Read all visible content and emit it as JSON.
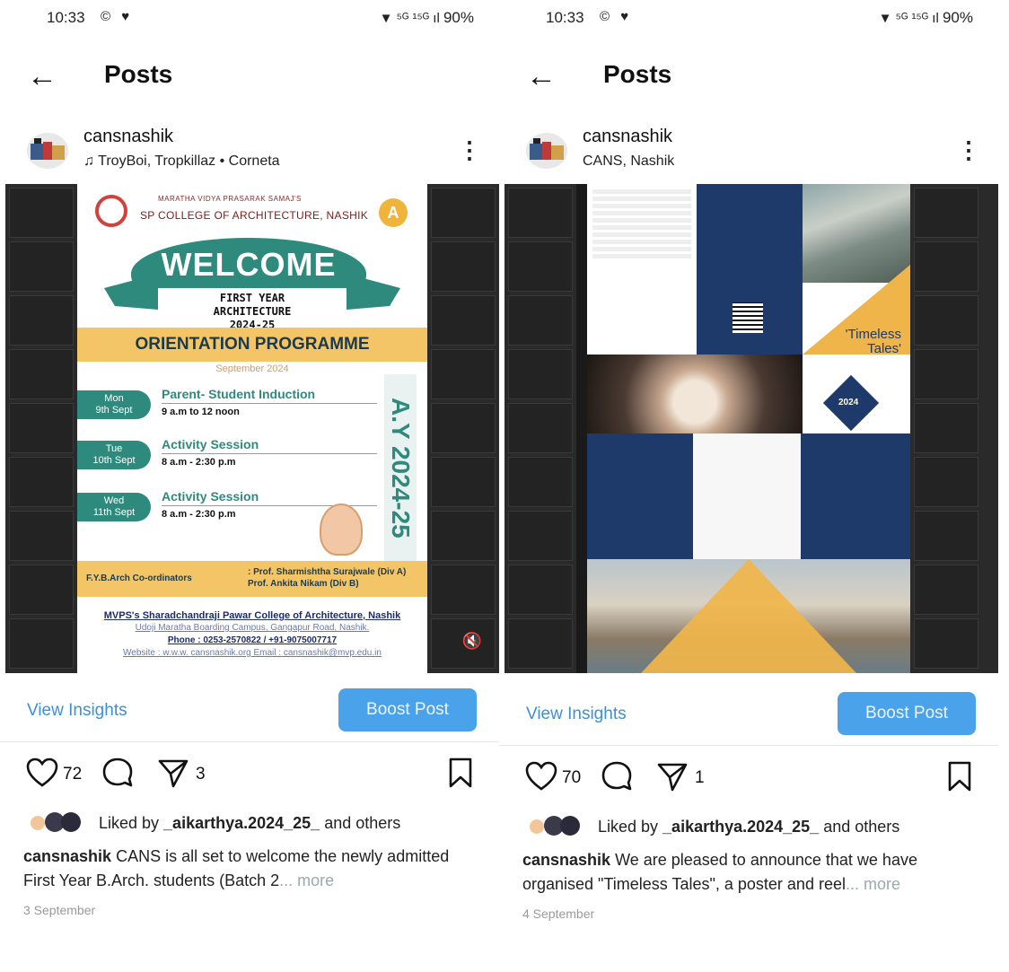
{
  "left": {
    "status": {
      "time": "10:33",
      "notifs": "© ♥",
      "icons": "▼ ⁵ᴳ ¹⁵ᴳ ıl",
      "battery": "90%"
    },
    "header_title": "Posts",
    "post": {
      "username": "cansnashik",
      "subline_icon": "music-note-icon",
      "subline": "TroyBoi, Tropkillaz • Corneta",
      "poster": {
        "org": "MARATHA VIDYA PRASARAK SAMAJ'S",
        "college": "SP COLLEGE OF ARCHITECTURE, NASHIK",
        "welcome": "WELCOME",
        "firstyear_lines": [
          "FIRST YEAR",
          "ARCHITECTURE",
          "2024-25"
        ],
        "orientation": "ORIENTATION PROGRAMME",
        "month": "September 2024",
        "schedule": [
          {
            "day": "Mon",
            "date": "9th Sept",
            "event": "Parent- Student Induction",
            "time": "9 a.m to 12 noon"
          },
          {
            "day": "Tue",
            "date": "10th Sept",
            "event": "Activity Session",
            "time": "8 a.m - 2:30 p.m"
          },
          {
            "day": "Wed",
            "date": "11th Sept",
            "event": "Activity Session",
            "time": "8 a.m - 2:30 p.m"
          }
        ],
        "ay": "A.Y  2024-25",
        "coord_label": "F.Y.B.Arch Co-ordinators",
        "coord_lines": [
          ": Prof. Sharmishtha Surajwale  (Div A)",
          "  Prof. Ankita Nikam  (Div B)"
        ],
        "footer_title": "MVPS's Sharadchandraji Pawar College of Architecture, Nashik",
        "footer_address": "Udoji Maratha Boarding Campus, Gangapur Road, Nashik.",
        "footer_phone": "Phone : 0253-2570822 / +91-9075007717",
        "footer_web": "Website : w.w.w. cansnashik.org      Email : cansnashik@mvp.edu.in"
      },
      "view_insights": "View Insights",
      "boost": "Boost Post",
      "likes_count": "72",
      "shares_count": "3",
      "liked_by_prefix": "Liked by ",
      "liked_by_user": "_aikarthya.2024_25_",
      "liked_by_suffix": " and others",
      "caption_user": "cansnashik",
      "caption_text": " CANS is all set to welcome the newly admitted First Year B.Arch. students (Batch 2",
      "caption_more": "... more",
      "date": "3 September"
    }
  },
  "right": {
    "status": {
      "time": "10:33",
      "notifs": "© ♥",
      "icons": "▼ ⁵ᴳ ¹⁵ᴳ ıl",
      "battery": "90%"
    },
    "header_title": "Posts",
    "post": {
      "username": "cansnashik",
      "subline": "CANS, Nashik",
      "poster": {
        "title_line1": "'Timeless",
        "title_line2": "Tales'",
        "year": "2024"
      },
      "view_insights": "View Insights",
      "boost": "Boost Post",
      "likes_count": "70",
      "shares_count": "1",
      "liked_by_prefix": "Liked by ",
      "liked_by_user": "_aikarthya.2024_25_",
      "liked_by_suffix": " and others",
      "caption_user": "cansnashik",
      "caption_text": " We are pleased to announce that we have organised \"Timeless Tales\", a poster and reel",
      "caption_more": "... more",
      "date": "4 September"
    }
  },
  "colors": {
    "accent_blue": "#4aa3ea",
    "link_blue": "#3d8fd6",
    "teal": "#2d8a7c",
    "gold": "#f4c567",
    "navy": "#1e3a6b"
  }
}
